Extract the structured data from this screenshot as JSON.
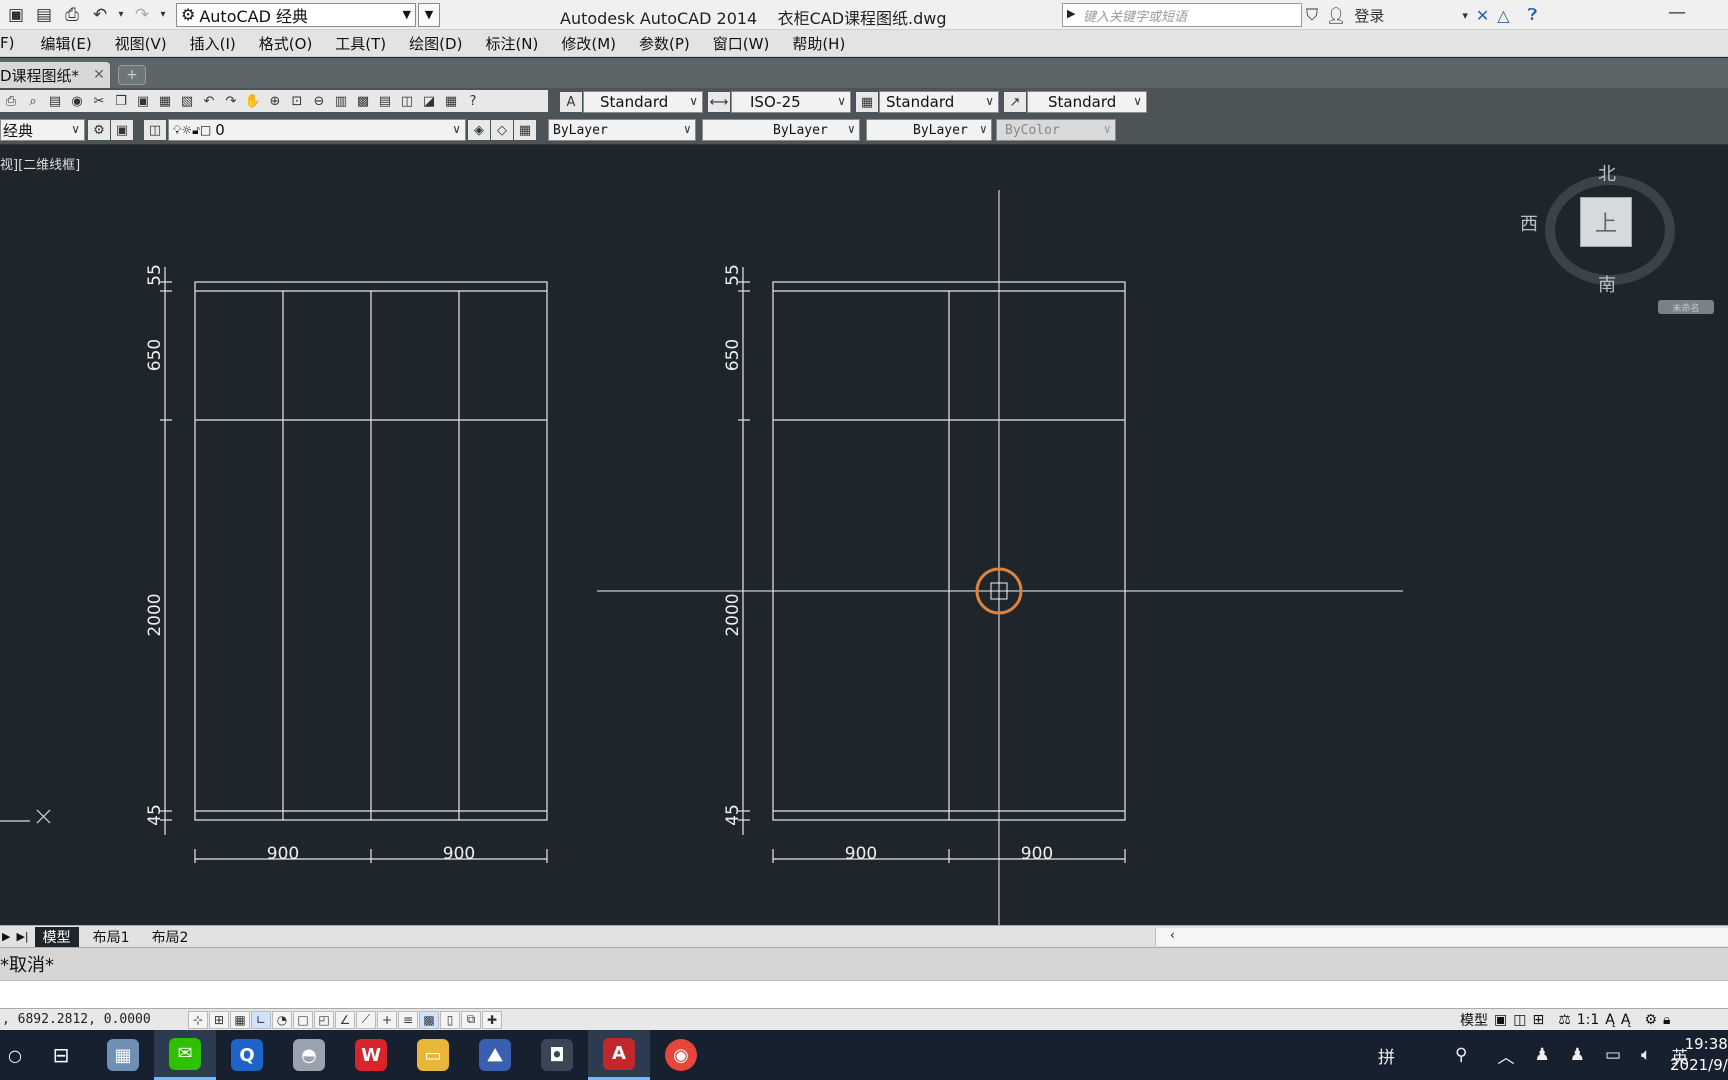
{
  "title_bar": {
    "workspace": "AutoCAD 经典",
    "app_title": "Autodesk AutoCAD 2014    衣柜CAD课程图纸.dwg",
    "search_placeholder": "键入关键字或短语",
    "login": "登录"
  },
  "menu": [
    "F)",
    "编辑(E)",
    "视图(V)",
    "插入(I)",
    "格式(O)",
    "工具(T)",
    "绘图(D)",
    "标注(N)",
    "修改(M)",
    "参数(P)",
    "窗口(W)",
    "帮助(H)"
  ],
  "doc_tab": {
    "label": "D课程图纸*"
  },
  "styles_toolbar": {
    "text_style": "Standard",
    "dim_style": "ISO-25",
    "table_style": "Standard",
    "mleader_style": "Standard"
  },
  "layers_toolbar": {
    "workspace_short": "经典",
    "layer": "0",
    "color": "ByLayer",
    "linetype": "ByLayer",
    "lineweight": "ByLayer",
    "plotstyle": "ByColor"
  },
  "viewport": {
    "label": "视][二维线框]",
    "viewcube": {
      "north": "北",
      "west": "西",
      "south": "南",
      "top_face": "上",
      "ucs": "未命名"
    }
  },
  "drawings": [
    {
      "dims_vertical": [
        "55",
        "650",
        "2000",
        "45"
      ],
      "dims_horizontal": [
        "900",
        "900"
      ]
    },
    {
      "dims_vertical": [
        "55",
        "650",
        "2000",
        "45"
      ],
      "dims_horizontal": [
        "900",
        "900"
      ]
    }
  ],
  "layout_tabs": [
    "模型",
    "布局1",
    "布局2"
  ],
  "command_history": "*取消*",
  "status": {
    "coords": ", 6892.2812, 0.0000",
    "model": "模型",
    "scale": "1:1"
  },
  "taskbar": {
    "ime": "拼",
    "lang": "英",
    "time": "19:38",
    "date": "2021/9/"
  }
}
